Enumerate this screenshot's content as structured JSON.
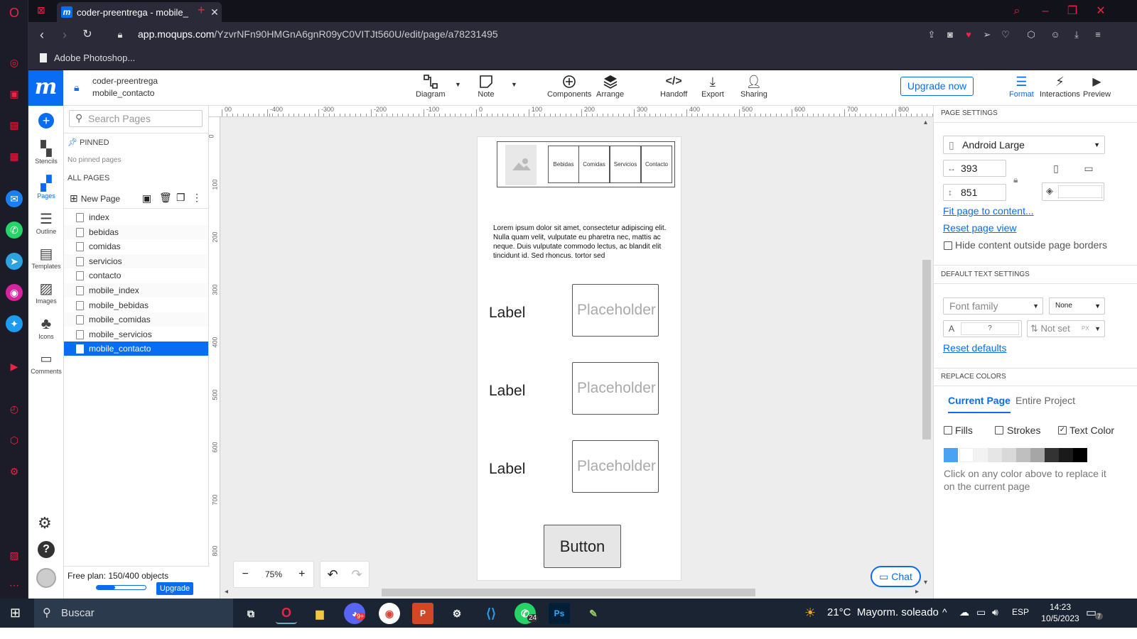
{
  "browser": {
    "tab_title": "coder-preentrega - mobile_",
    "url_host": "app.moqups.com",
    "url_path": "/YzvrNFn90HMGnA6gnR09yC0VITJt560U/edit/page/a78231495",
    "bookmark": "Adobe Photoshop..."
  },
  "app": {
    "logo": "m",
    "project_name": "coder-preentrega",
    "page_name": "mobile_contacto",
    "toolbar": {
      "diagram": "Diagram",
      "note": "Note",
      "components": "Components",
      "arrange": "Arrange",
      "handoff": "Handoff",
      "export": "Export",
      "sharing": "Sharing",
      "upgrade": "Upgrade now",
      "format": "Format",
      "interactions": "Interactions",
      "preview": "Preview"
    }
  },
  "rail": {
    "stencils": "Stencils",
    "pages": "Pages",
    "outline": "Outline",
    "templates": "Templates",
    "images": "Images",
    "icons": "Icons",
    "comments": "Comments"
  },
  "pages_panel": {
    "search_placeholder": "Search Pages",
    "pinned": "PINNED",
    "no_pinned": "No pinned pages",
    "all_pages": "ALL PAGES",
    "new_page": "New Page",
    "pages": [
      "index",
      "bebidas",
      "comidas",
      "servicios",
      "contacto",
      "mobile_index",
      "mobile_bebidas",
      "mobile_comidas",
      "mobile_servicios",
      "mobile_contacto"
    ],
    "selected_index": 9,
    "plan_text": "Free plan: 150/400 objects",
    "plan_usage": 0.375,
    "upgrade": "Upgrade"
  },
  "rulers": {
    "h": [
      "00",
      "-400",
      "-300",
      "-200",
      "-100",
      "0",
      "100",
      "200",
      "300",
      "400",
      "500",
      "600",
      "700",
      "800"
    ],
    "v": [
      "0",
      "100",
      "200",
      "300",
      "400",
      "500",
      "600",
      "700",
      "800"
    ]
  },
  "wireframe": {
    "nav": [
      "Bebidas",
      "Comidas",
      "Servicios",
      "Contacto"
    ],
    "lorem": "Lorem ipsum dolor sit amet, consectetur adipiscing elit. Nulla quam velit, vulputate eu pharetra nec, mattis ac neque. Duis vulputate commodo lectus, ac blandit elit tincidunt id. Sed rhoncus, tortor sed",
    "fields": [
      {
        "label": "Label",
        "placeholder": "Placeholder"
      },
      {
        "label": "Label",
        "placeholder": "Placeholder"
      },
      {
        "label": "Label",
        "placeholder": "Placeholder"
      }
    ],
    "button": "Button"
  },
  "canvas": {
    "zoom": "75%",
    "chat": "Chat"
  },
  "right_panel": {
    "page_settings": "PAGE SETTINGS",
    "device": "Android Large",
    "width": "393",
    "height": "851",
    "fit_page": "Fit page to content...",
    "reset_view": "Reset page view",
    "hide_content": "Hide content outside page borders",
    "default_text": "DEFAULT TEXT SETTINGS",
    "font_family": "Font family",
    "font_weight": "None",
    "font_size": "?",
    "line_height": "Not set",
    "unit": "PX",
    "reset_defaults": "Reset defaults",
    "replace_colors": "REPLACE COLORS",
    "tab_current": "Current Page",
    "tab_entire": "Entire Project",
    "fills": "Fills",
    "strokes": "Strokes",
    "text_color": "Text Color",
    "text_color_checked": true,
    "swatches": [
      "#4aa3f2",
      "#ffffff",
      "#f2f2f2",
      "#e6e6e6",
      "#d9d9d9",
      "#bfbfbf",
      "#a6a6a6",
      "#333333",
      "#1a1a1a",
      "#000000"
    ],
    "hint": "Click on any color above to replace it on the current page"
  },
  "taskbar": {
    "search": "Buscar",
    "weather": "21°C  Mayorm. soleado",
    "lang": "ESP",
    "time": "14:23",
    "date": "10/5/2023",
    "notifications": "7",
    "whatsapp_badge": "24",
    "discord_badge": "9+"
  }
}
